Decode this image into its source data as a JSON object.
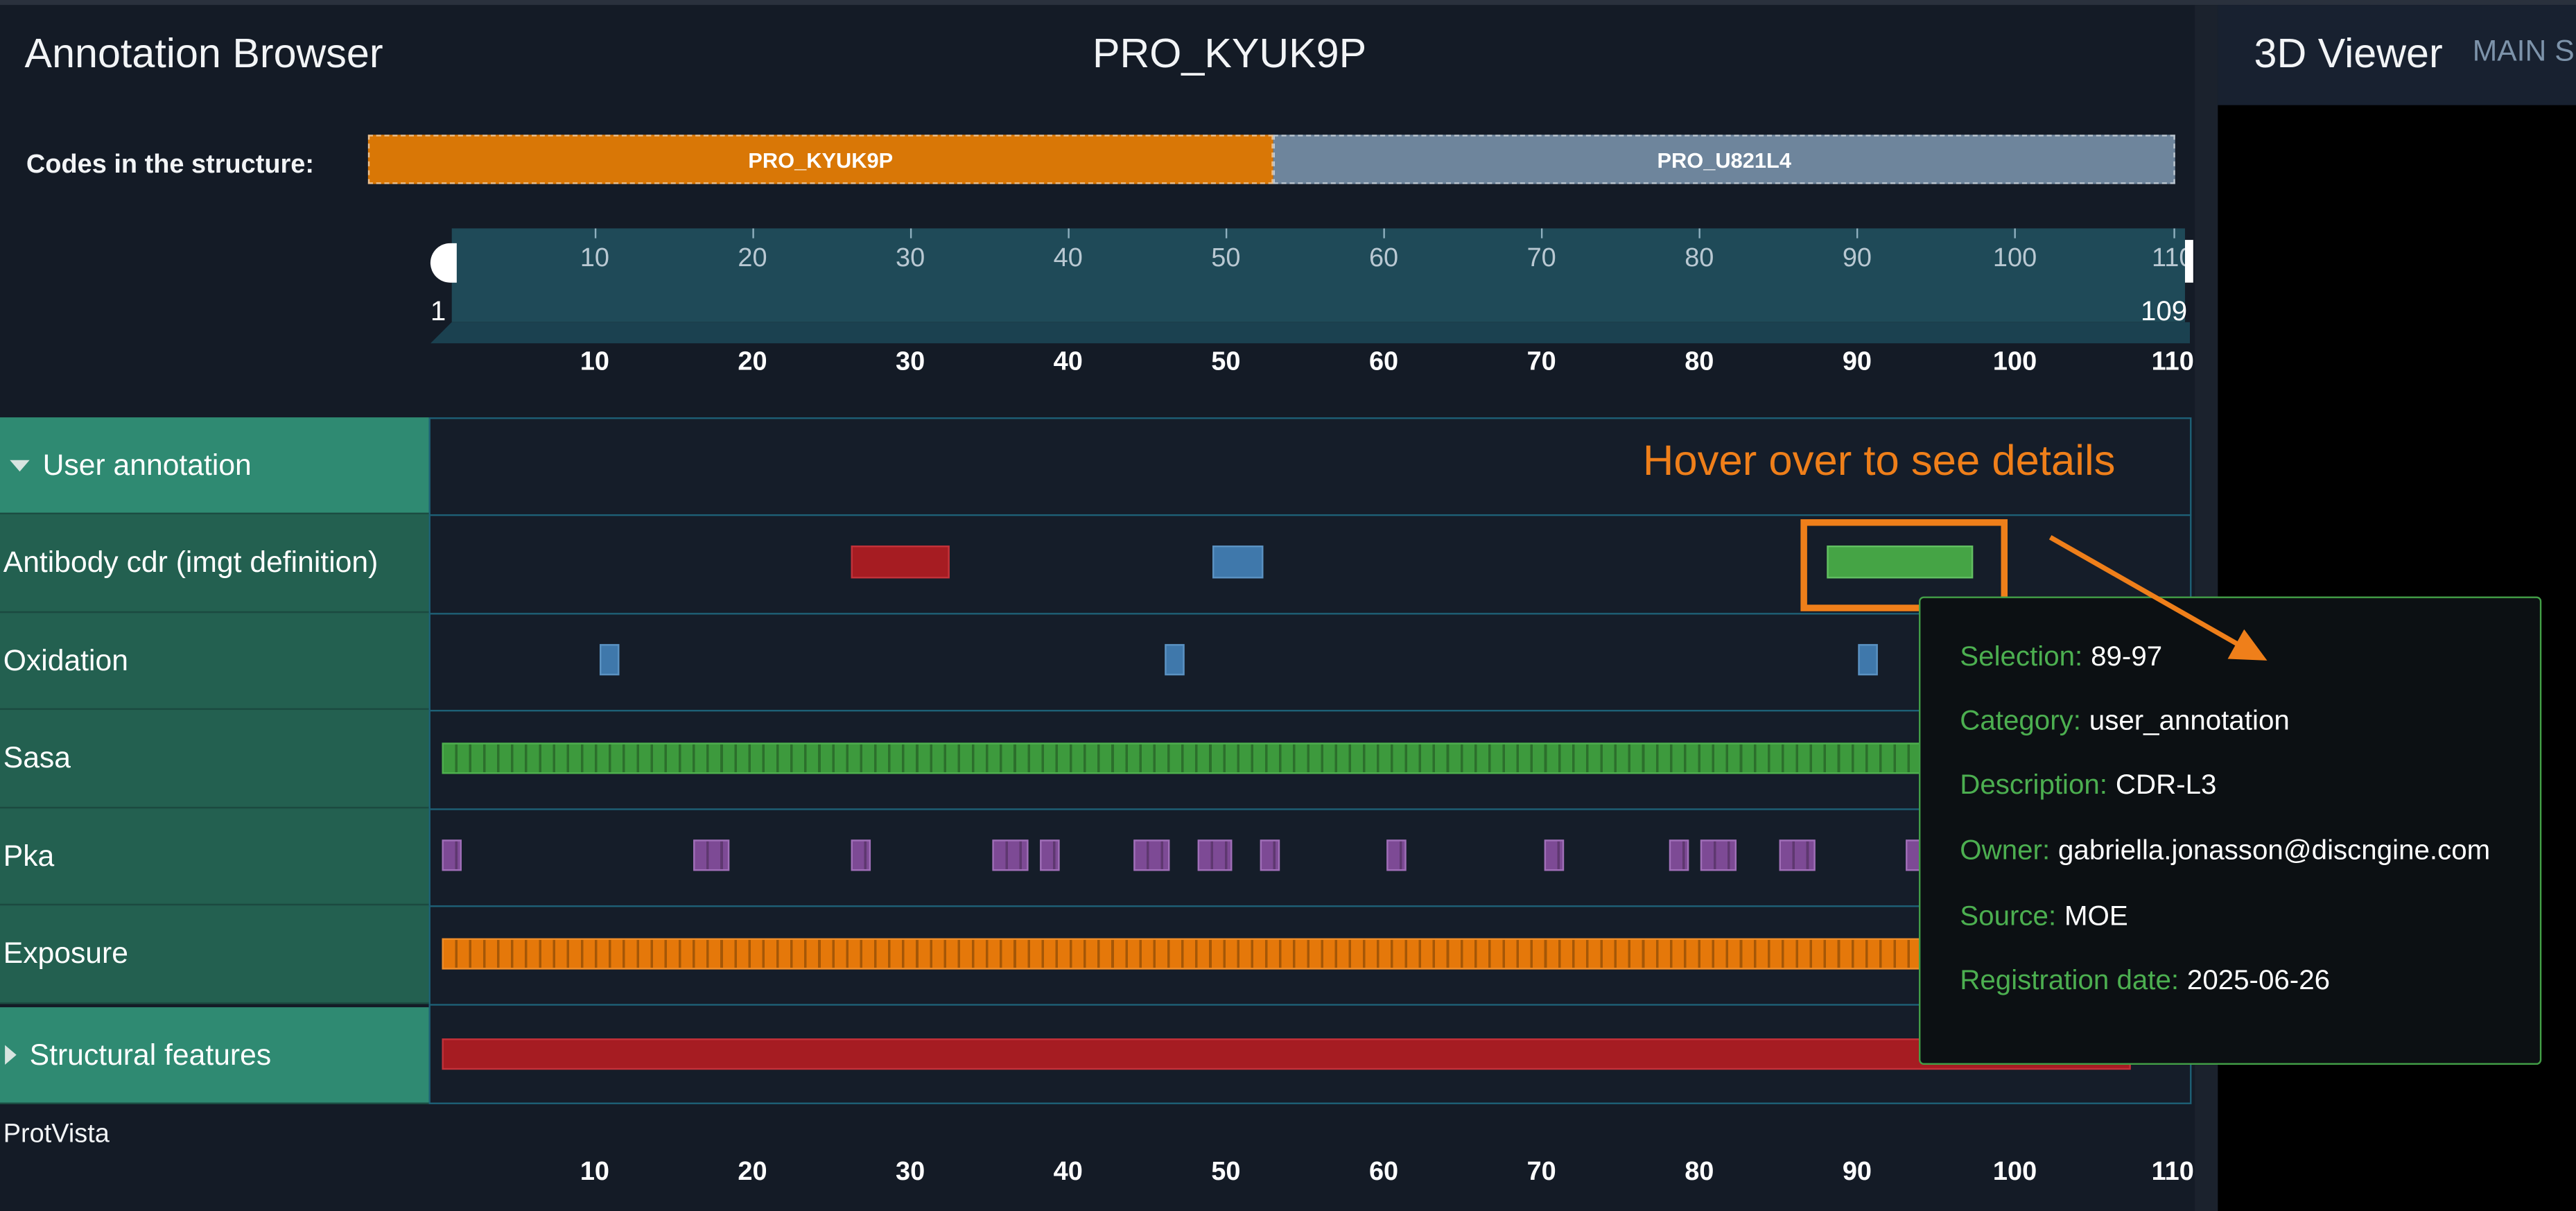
{
  "header": {
    "app_title": "Annotation Browser",
    "structure_title": "PRO_KYUK9P"
  },
  "codes": {
    "label": "Codes in the structure:",
    "items": [
      {
        "name": "PRO_KYUK9P",
        "color": "#d97706"
      },
      {
        "name": "PRO_U821L4",
        "color": "#6e859c"
      }
    ]
  },
  "navigation": {
    "ticks": [
      "10",
      "20",
      "30",
      "40",
      "50",
      "60",
      "70",
      "80",
      "90",
      "100",
      "110"
    ],
    "range_start": "1",
    "range_end": "109"
  },
  "axis_ticks": [
    "10",
    "20",
    "30",
    "40",
    "50",
    "60",
    "70",
    "80",
    "90",
    "100",
    "110"
  ],
  "tracks": {
    "user_annotation": "User annotation",
    "antibody_cdr": "Antibody cdr (imgt definition)",
    "oxidation": "Oxidation",
    "sasa": "Sasa",
    "pka": "Pka",
    "exposure": "Exposure",
    "structural_features": "Structural features"
  },
  "footer": {
    "label": "ProtVista"
  },
  "viewer": {
    "title": "3D Viewer",
    "tab": "MAIN S"
  },
  "hint": {
    "text": "Hover over to see details"
  },
  "tooltip": {
    "selection_key": "Selection:",
    "selection_val": "89-97",
    "category_key": "Category:",
    "category_val": "user_annotation",
    "description_key": "Description:",
    "description_val": "CDR-L3",
    "owner_key": "Owner:",
    "owner_val": "gabriella.jonasson@discngine.com",
    "source_key": "Source:",
    "source_val": "MOE",
    "date_key": "Registration date:",
    "date_val": "2025-06-26"
  },
  "colors": {
    "background": "#141b26",
    "track_label": "#236050",
    "track_label_head": "#2f8a72",
    "accent_orange": "#ef7f1a",
    "tooltip_border": "#43a047"
  }
}
